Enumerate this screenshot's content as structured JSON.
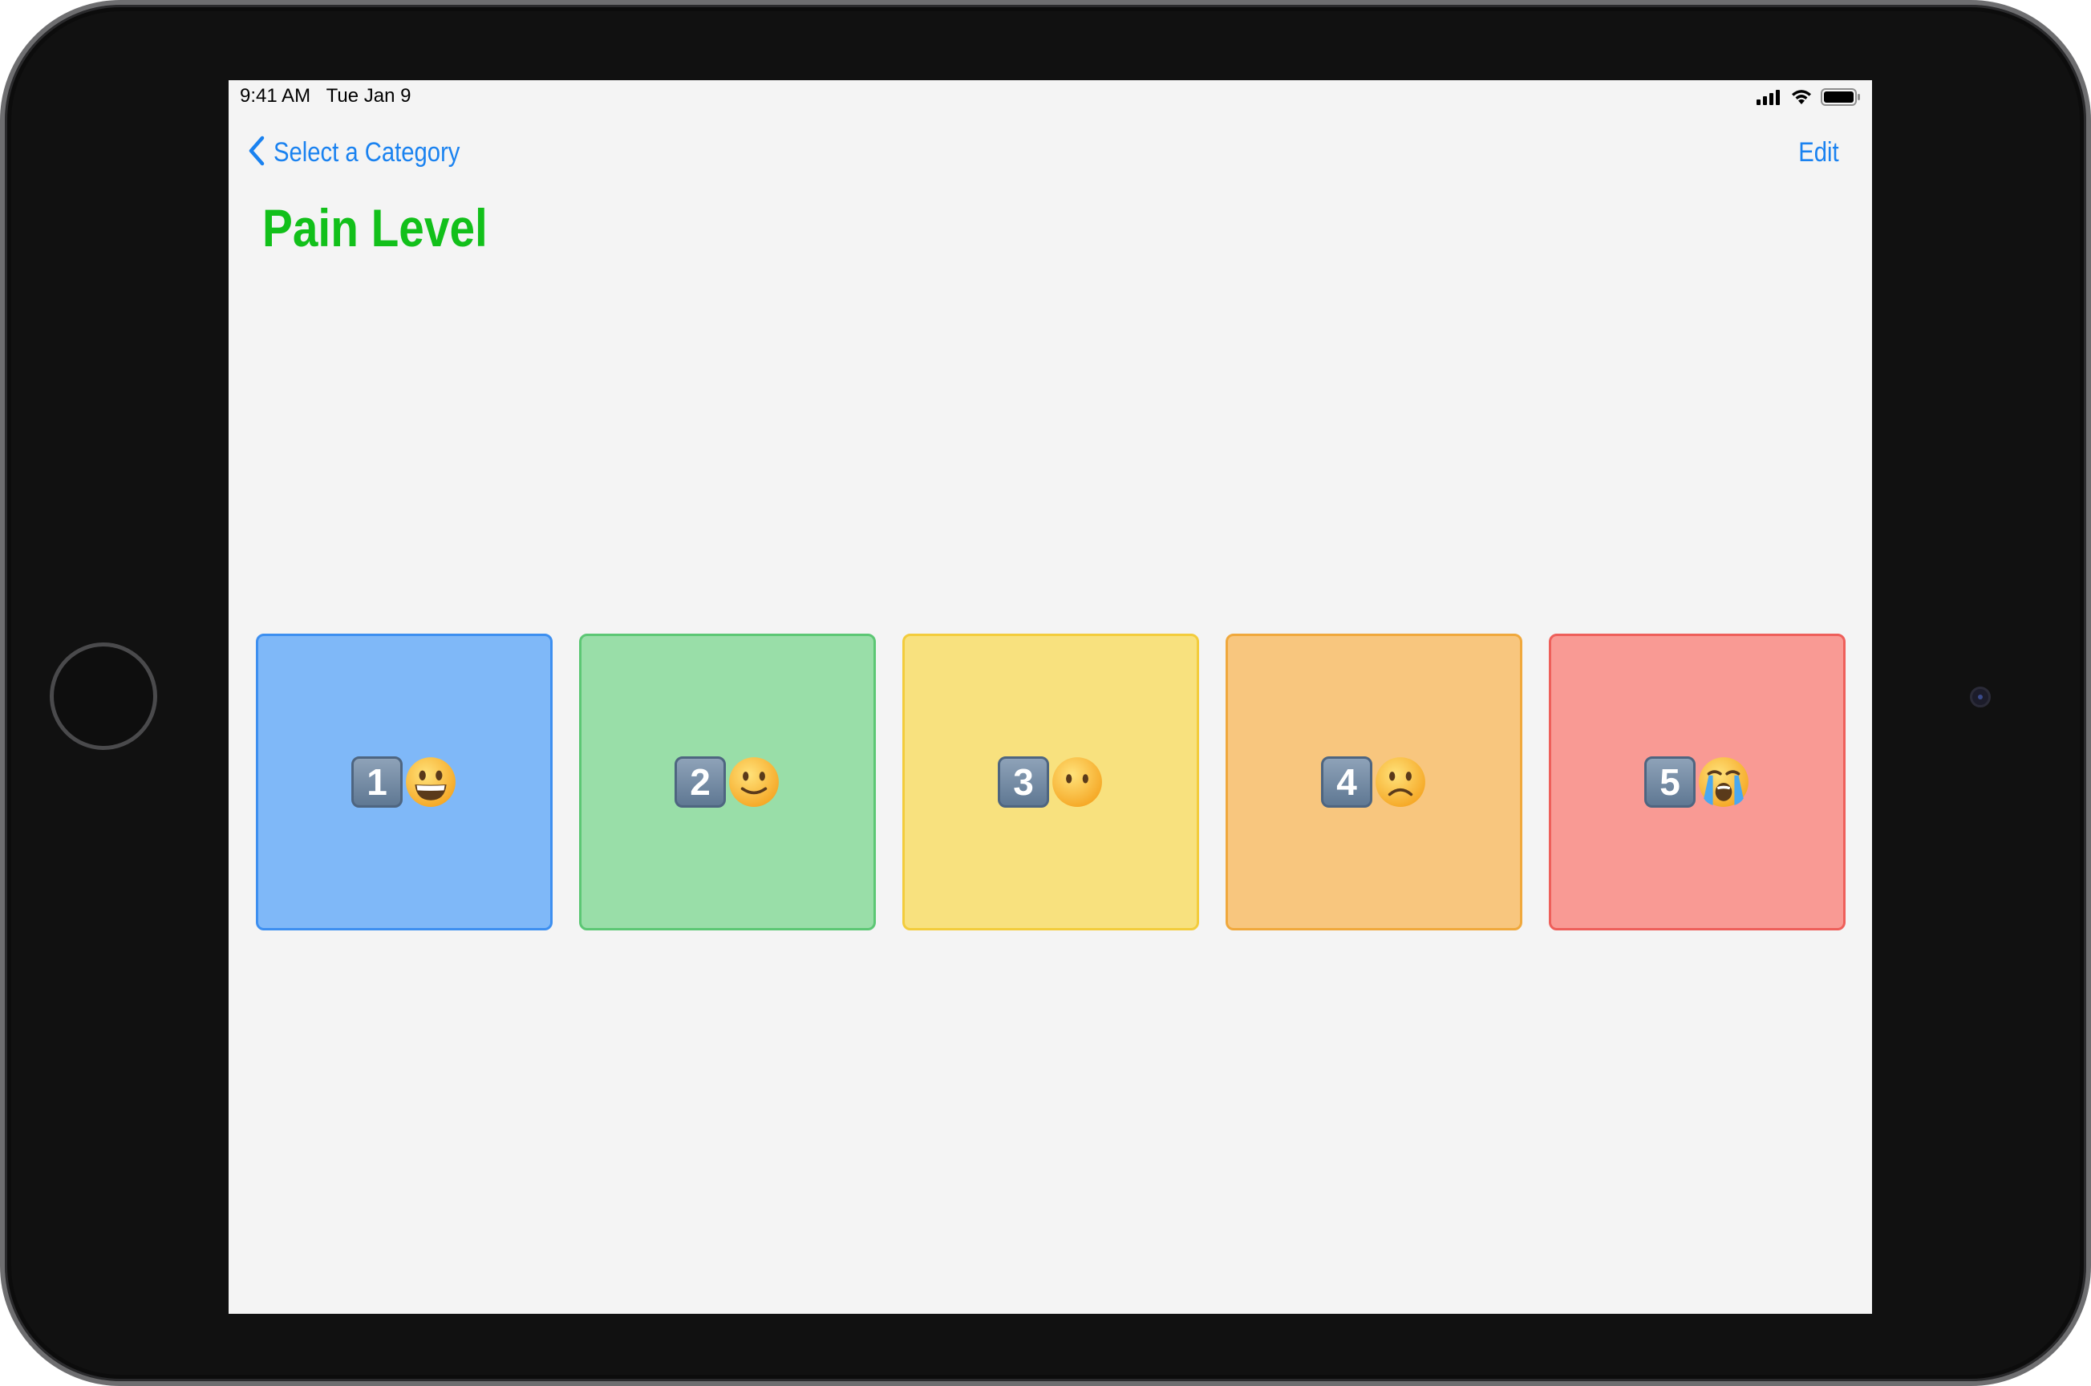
{
  "status_bar": {
    "time": "9:41 AM",
    "date": "Tue Jan 9",
    "icons": [
      "cellular-signal-icon",
      "wifi-icon",
      "battery-icon"
    ]
  },
  "nav": {
    "back_label": "Select a Category",
    "back_icon": "chevron-left-icon",
    "edit_label": "Edit",
    "tint_color": "#1a82f0"
  },
  "page": {
    "title": "Pain Level",
    "title_color": "#12c01a"
  },
  "tiles": [
    {
      "number": "1",
      "emoji": "grinning-face-icon",
      "fill": "#7fb8f8",
      "border": "#3d8ff0"
    },
    {
      "number": "2",
      "emoji": "slightly-smiling-face-icon",
      "fill": "#99dea8",
      "border": "#5cc774"
    },
    {
      "number": "3",
      "emoji": "face-without-mouth-icon",
      "fill": "#f8e17e",
      "border": "#f3cc3c"
    },
    {
      "number": "4",
      "emoji": "slightly-frowning-face-icon",
      "fill": "#f8c67e",
      "border": "#f0a83c"
    },
    {
      "number": "5",
      "emoji": "loudly-crying-face-icon",
      "fill": "#f99a94",
      "border": "#ee5f5a"
    }
  ]
}
